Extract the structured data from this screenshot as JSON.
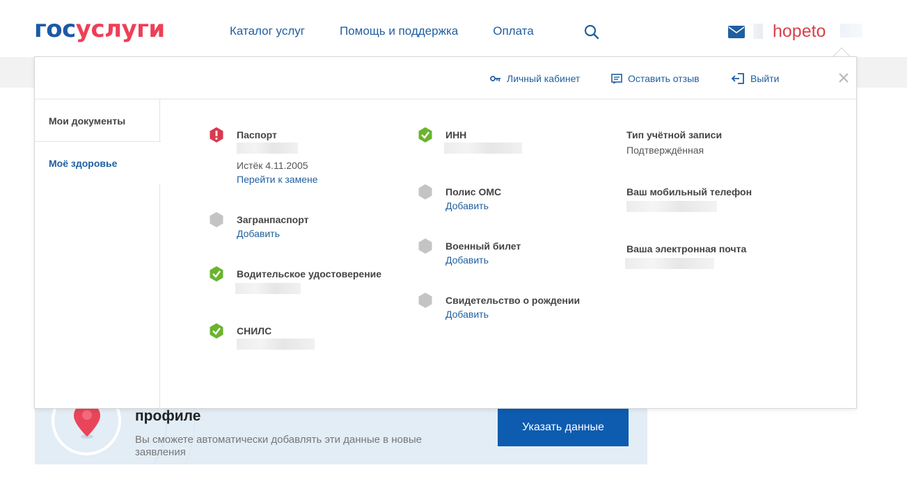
{
  "header": {
    "logo_part1": "гос",
    "logo_part2": "услуги",
    "nav": [
      "Каталог услуг",
      "Помощь и поддержка",
      "Оплата"
    ],
    "username": "hopeto",
    "colors": {
      "brand_blue": "#1b5aa6",
      "brand_red": "#ee3f58",
      "link": "#1f5fa0"
    }
  },
  "banner": {
    "title": "профиле",
    "text": "Вы сможете автоматически добавлять эти данные в новые заявления",
    "button": "Указать данные"
  },
  "panel": {
    "top_links": {
      "cabinet": "Личный кабинет",
      "feedback": "Оставить отзыв",
      "logout": "Выйти"
    },
    "sidebar": {
      "docs": "Мои документы",
      "health": "Моё здоровье"
    },
    "docs": {
      "passport": {
        "title": "Паспорт",
        "status": "error",
        "expired": "Истёк 4.11.2005",
        "link": "Перейти к замене"
      },
      "zagran": {
        "title": "Загранпаспорт",
        "status": "empty",
        "link": "Добавить"
      },
      "driver": {
        "title": "Водительское удостоверение",
        "status": "ok"
      },
      "snils": {
        "title": "СНИЛС",
        "status": "ok"
      },
      "inn": {
        "title": "ИНН",
        "status": "ok"
      },
      "oms": {
        "title": "Полис ОМС",
        "status": "empty",
        "link": "Добавить"
      },
      "military": {
        "title": "Военный билет",
        "status": "empty",
        "link": "Добавить"
      },
      "birth": {
        "title": "Свидетельство о рождении",
        "status": "empty",
        "link": "Добавить"
      }
    },
    "account": {
      "type_label": "Тип учётной записи",
      "type_value": "Подтверждённая",
      "phone_label": "Ваш мобильный телефон",
      "email_label": "Ваша электронная почта"
    }
  }
}
